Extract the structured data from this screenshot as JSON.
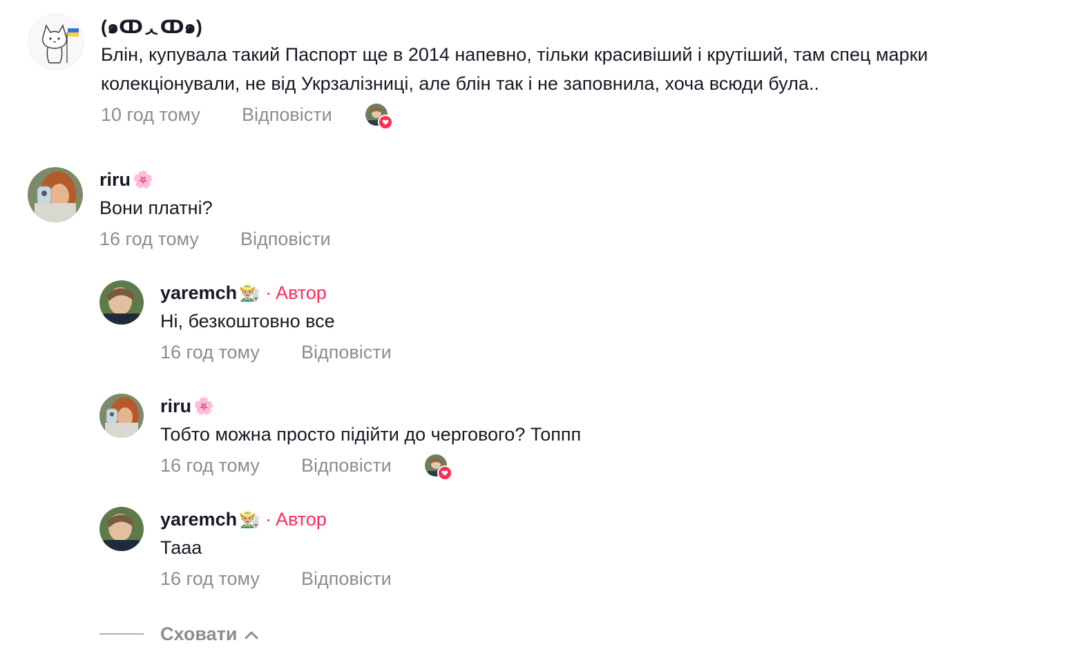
{
  "comments": [
    {
      "username": "(๑ↀᆺↀ๑)",
      "emoji": "",
      "text_lines": [
        "Блін, купувала такий Паспорт ще в 2014 напевно, тільки красивіший і крутіший, там спец марки",
        "колекціонували, не від Укрзалізниці, але блін так і не заповнила, хоча всюди була.."
      ],
      "time": "10 год тому",
      "reply_label": "Відповісти",
      "liked_by_author": true
    },
    {
      "username": "riru",
      "emoji": "🌸",
      "text_lines": [
        "Вони платні?"
      ],
      "time": "16 год тому",
      "reply_label": "Відповісти",
      "liked_by_author": false
    }
  ],
  "replies": [
    {
      "username": "yaremch",
      "emoji": "👨🏼‍🌾",
      "author_separator": "·",
      "author_label": "Автор",
      "text": "Ні, безкоштовно все",
      "time": "16 год тому",
      "reply_label": "Відповісти",
      "liked_by_author": false
    },
    {
      "username": "riru",
      "emoji": "🌸",
      "text": "Тобто можна просто підійти до чергового? Топпп",
      "time": "16 год тому",
      "reply_label": "Відповісти",
      "liked_by_author": true
    },
    {
      "username": "yaremch",
      "emoji": "👨🏼‍🌾",
      "author_separator": "·",
      "author_label": "Автор",
      "text": "Тааа",
      "time": "16 год тому",
      "reply_label": "Відповісти",
      "liked_by_author": false
    }
  ],
  "hide_replies": {
    "label": "Сховати",
    "icon": "chevron-up-icon"
  },
  "colors": {
    "accent": "#fe2c55",
    "text": "#161823",
    "muted": "#8a8b91"
  }
}
